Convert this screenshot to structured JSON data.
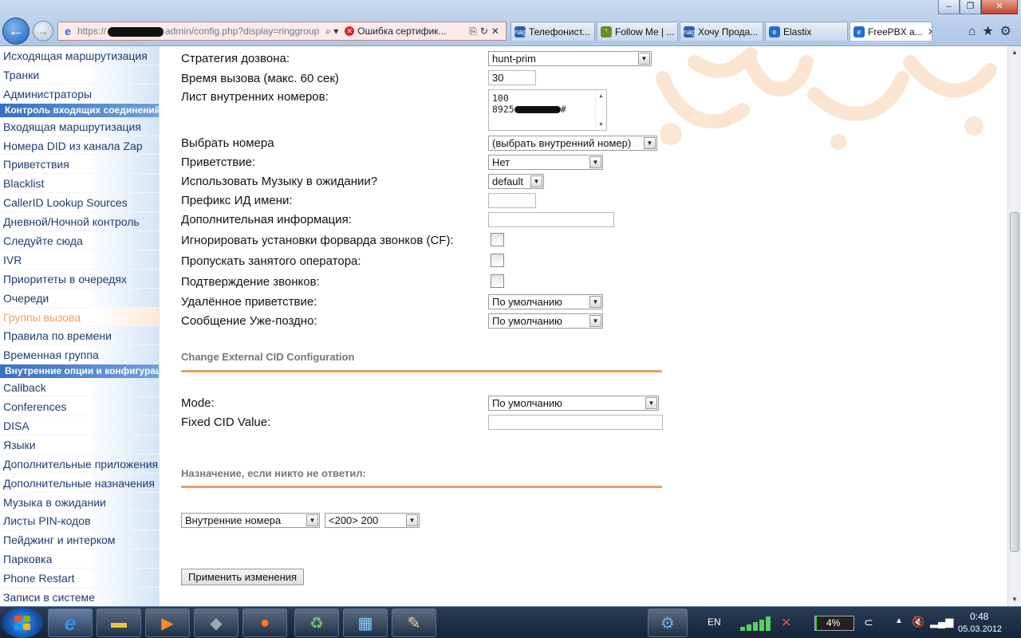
{
  "browser": {
    "address": {
      "scheme": "https://",
      "path": "admin/config.php?display=ringgroup",
      "cert_warning": "Ошибка сертифик..."
    },
    "tabs": [
      {
        "label": "Телефонист...",
        "fav": "nag",
        "fav_color": "#2b5fb5"
      },
      {
        "label": "Follow Me | ...",
        "fav": "\"",
        "fav_color": "#6b8e23"
      },
      {
        "label": "Хочу Прода...",
        "fav": "nag",
        "fav_color": "#2b5fb5"
      },
      {
        "label": "Elastix",
        "fav": "e",
        "fav_color": "#1f6fd0"
      },
      {
        "label": "FreePBX a...",
        "fav": "e",
        "fav_color": "#1f6fd0",
        "active": true
      }
    ]
  },
  "sidebar": {
    "items": [
      {
        "label": "Исходящая маршрутизация"
      },
      {
        "label": "Транки"
      },
      {
        "label": "Администраторы"
      },
      {
        "label": "Контроль входящих соединений",
        "header": true
      },
      {
        "label": "Входящая маршрутизация"
      },
      {
        "label": "Номера DID из канала Zap"
      },
      {
        "label": "Приветствия"
      },
      {
        "label": "Blacklist"
      },
      {
        "label": "CallerID Lookup Sources"
      },
      {
        "label": "Дневной/Ночной контроль"
      },
      {
        "label": "Следуйте сюда"
      },
      {
        "label": "IVR"
      },
      {
        "label": "Приоритеты в очередях"
      },
      {
        "label": "Очереди"
      },
      {
        "label": "Группы вызова",
        "current": true
      },
      {
        "label": "Правила по времени"
      },
      {
        "label": "Временная группа"
      },
      {
        "label": "Внутренние опции и конфигурация",
        "header": true
      },
      {
        "label": "Callback"
      },
      {
        "label": "Conferences"
      },
      {
        "label": "DISA"
      },
      {
        "label": "Языки"
      },
      {
        "label": "Дополнительные приложения"
      },
      {
        "label": "Дополнительные назначения"
      },
      {
        "label": "Музыка в ожидании"
      },
      {
        "label": "Листы PIN-кодов"
      },
      {
        "label": "Пейджинг и интерком"
      },
      {
        "label": "Парковка"
      },
      {
        "label": "Phone Restart"
      },
      {
        "label": "Записи в системе"
      }
    ]
  },
  "form": {
    "strategy": {
      "label": "Стратегия дозвона:",
      "value": "hunt-prim"
    },
    "ring_time": {
      "label": "Время вызова (макс. 60 сек)",
      "value": "30"
    },
    "ext_list": {
      "label": "Лист внутренних номеров:",
      "line1": "100",
      "line2_prefix": "8925",
      "line2_suffix": "#"
    },
    "pick_ext": {
      "label": "Выбрать номера",
      "value": "(выбрать внутренний номер)"
    },
    "announce": {
      "label": "Приветствие:",
      "value": "Нет"
    },
    "moh": {
      "label": "Использовать Музыку в ожидании?",
      "value": "default"
    },
    "cid_prefix": {
      "label": "Префикс ИД имени:",
      "value": ""
    },
    "alert_info": {
      "label": "Дополнительная информация:",
      "value": ""
    },
    "ignore_cf": {
      "label": "Игнорировать установки форварда звонков (CF):"
    },
    "skip_busy": {
      "label": "Пропускать занятого оператора:"
    },
    "confirm": {
      "label": "Подтверждение звонков:"
    },
    "remote_announce": {
      "label": "Удалённое приветствие:",
      "value": "По умолчанию"
    },
    "too_late": {
      "label": "Сообщение Уже-поздно:",
      "value": "По умолчанию"
    },
    "cid_section": {
      "title": "Change External CID Configuration"
    },
    "mode": {
      "label": "Mode:",
      "value": "По умолчанию"
    },
    "fixed_cid": {
      "label": "Fixed CID Value:",
      "value": ""
    },
    "dest_section": {
      "title": "Назначение, если никто не ответил:"
    },
    "dest_type": {
      "value": "Внутренние номера"
    },
    "dest_target": {
      "value": "<200> 200"
    },
    "apply": "Применить изменения"
  },
  "taskbar": {
    "lang": "EN",
    "battery": "4%",
    "battery_level": 0.04,
    "time": "0:48",
    "date": "05.03.2012"
  }
}
